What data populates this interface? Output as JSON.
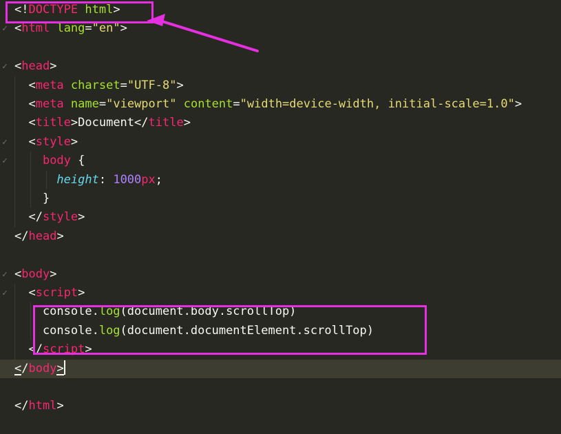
{
  "editor": {
    "theme": {
      "background": "#272822",
      "active_line": "#3E3D32",
      "plain": "#F8F8F2",
      "tag": "#F92672",
      "attribute": "#A6E22E",
      "string": "#E6DB74",
      "property": "#66D9EF",
      "number": "#AE81FF",
      "annotation": "#E52FE0"
    },
    "lines": [
      {
        "tokens": [
          [
            "plain",
            "<!"
          ],
          [
            "tag",
            "DOCTYPE"
          ],
          [
            "plain",
            " "
          ],
          [
            "attribute",
            "html"
          ],
          [
            "plain",
            ">"
          ]
        ]
      },
      {
        "fold": true,
        "tokens": [
          [
            "plain",
            "<"
          ],
          [
            "tag",
            "html"
          ],
          [
            "plain",
            " "
          ],
          [
            "attribute",
            "lang"
          ],
          [
            "plain",
            "="
          ],
          [
            "string",
            "\"en\""
          ],
          [
            "plain",
            ">"
          ]
        ]
      },
      {
        "tokens": []
      },
      {
        "fold": true,
        "tokens": [
          [
            "plain",
            "<"
          ],
          [
            "tag",
            "head"
          ],
          [
            "plain",
            ">"
          ]
        ]
      },
      {
        "tokens": [
          [
            "plain",
            "  <"
          ],
          [
            "tag",
            "meta"
          ],
          [
            "plain",
            " "
          ],
          [
            "attribute",
            "charset"
          ],
          [
            "plain",
            "="
          ],
          [
            "string",
            "\"UTF-8\""
          ],
          [
            "plain",
            ">"
          ]
        ]
      },
      {
        "tokens": [
          [
            "plain",
            "  <"
          ],
          [
            "tag",
            "meta"
          ],
          [
            "plain",
            " "
          ],
          [
            "attribute",
            "name"
          ],
          [
            "plain",
            "="
          ],
          [
            "string",
            "\"viewport\""
          ],
          [
            "plain",
            " "
          ],
          [
            "attribute",
            "content"
          ],
          [
            "plain",
            "="
          ],
          [
            "string",
            "\"width=device-width, initial-scale=1.0\""
          ],
          [
            "plain",
            ">"
          ]
        ]
      },
      {
        "tokens": [
          [
            "plain",
            "  <"
          ],
          [
            "tag",
            "title"
          ],
          [
            "plain",
            ">Document</"
          ],
          [
            "tag",
            "title"
          ],
          [
            "plain",
            ">"
          ]
        ]
      },
      {
        "fold": true,
        "tokens": [
          [
            "plain",
            "  <"
          ],
          [
            "tag",
            "style"
          ],
          [
            "plain",
            ">"
          ]
        ]
      },
      {
        "fold": true,
        "tokens": [
          [
            "plain",
            "    "
          ],
          [
            "tag",
            "body"
          ],
          [
            "plain",
            " {"
          ]
        ]
      },
      {
        "tokens": [
          [
            "plain",
            "      "
          ],
          [
            "property",
            "height"
          ],
          [
            "plain",
            ": "
          ],
          [
            "number",
            "1000"
          ],
          [
            "tag",
            "px"
          ],
          [
            "plain",
            ";"
          ]
        ]
      },
      {
        "tokens": [
          [
            "plain",
            "    }"
          ]
        ]
      },
      {
        "tokens": [
          [
            "plain",
            "  </"
          ],
          [
            "tag",
            "style"
          ],
          [
            "plain",
            ">"
          ]
        ]
      },
      {
        "tokens": [
          [
            "plain",
            "</"
          ],
          [
            "tag",
            "head"
          ],
          [
            "plain",
            ">"
          ]
        ]
      },
      {
        "tokens": []
      },
      {
        "fold": true,
        "tokens": [
          [
            "plain",
            "<"
          ],
          [
            "tag",
            "body"
          ],
          [
            "plain",
            ">"
          ]
        ]
      },
      {
        "fold": true,
        "tokens": [
          [
            "plain",
            "  <"
          ],
          [
            "tag",
            "script"
          ],
          [
            "plain",
            ">"
          ]
        ]
      },
      {
        "tokens": [
          [
            "plain",
            "    console."
          ],
          [
            "attribute",
            "log"
          ],
          [
            "plain",
            "(document.body.scrollTop)"
          ]
        ]
      },
      {
        "tokens": [
          [
            "plain",
            "    console."
          ],
          [
            "attribute",
            "log"
          ],
          [
            "plain",
            "(document.documentElement.scrollTop)"
          ]
        ]
      },
      {
        "tokens": [
          [
            "plain",
            "  </"
          ],
          [
            "tag",
            "script"
          ],
          [
            "plain",
            ">"
          ]
        ]
      },
      {
        "active": true,
        "cursor": true,
        "tokens": [
          [
            "plain",
            "<"
          ],
          [
            "plain",
            "/"
          ],
          [
            "tag",
            "body"
          ],
          [
            "plain",
            ">"
          ]
        ]
      },
      {
        "tokens": []
      },
      {
        "tokens": [
          [
            "plain",
            "</"
          ],
          [
            "tag",
            "html"
          ],
          [
            "plain",
            ">"
          ]
        ]
      }
    ]
  }
}
